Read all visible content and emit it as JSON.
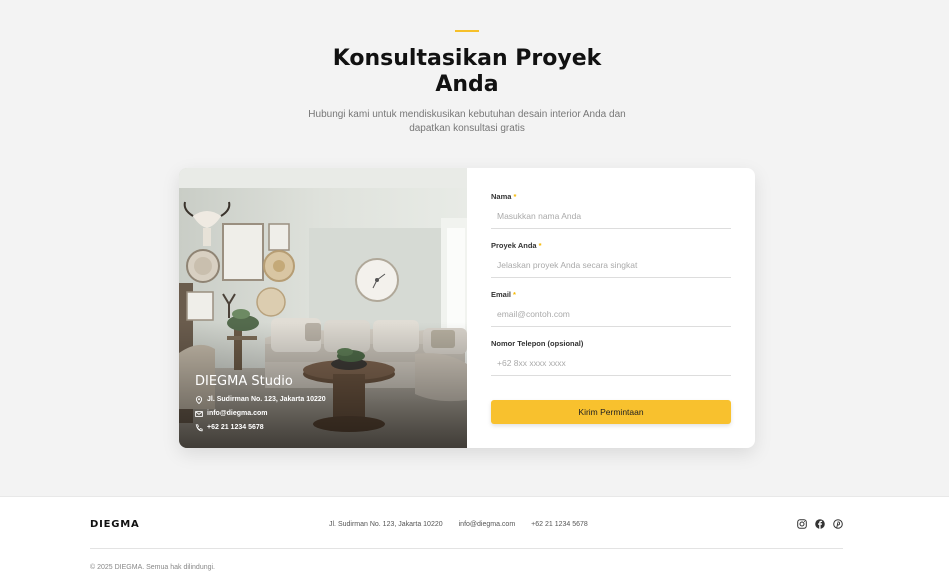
{
  "hero": {
    "title_line1": "Konsultasikan Proyek",
    "title_line2": "Anda",
    "subtitle": "Hubungi kami untuk mendiskusikan kebutuhan desain interior Anda dan dapatkan konsultasi gratis"
  },
  "studio": {
    "name": "DIEGMA Studio",
    "address": "Jl. Sudirman No. 123, Jakarta 10220",
    "email": "info@diegma.com",
    "phone": "+62 21 1234 5678"
  },
  "form": {
    "name_label": "Nama",
    "name_placeholder": "Masukkan nama Anda",
    "project_label": "Proyek Anda",
    "project_placeholder": "Jelaskan proyek Anda secara singkat",
    "email_label": "Email",
    "email_placeholder": "email@contoh.com",
    "phone_label": "Nomor Telepon (opsional)",
    "phone_placeholder": "+62 8xx xxxx xxxx",
    "required_mark": "*",
    "submit_label": "Kirim Permintaan"
  },
  "footer": {
    "brand": "DIEGMA",
    "address": "Jl. Sudirman No. 123, Jakarta 10220",
    "email": "info@diegma.com",
    "phone": "+62 21 1234 5678",
    "socials": [
      "instagram-icon",
      "facebook-icon",
      "pinterest-icon"
    ],
    "copyright": "© 2025 DIEGMA. Semua hak dilindungi."
  },
  "colors": {
    "accent": "#f8c12e",
    "background": "#f3f3f3",
    "card": "#ffffff"
  }
}
